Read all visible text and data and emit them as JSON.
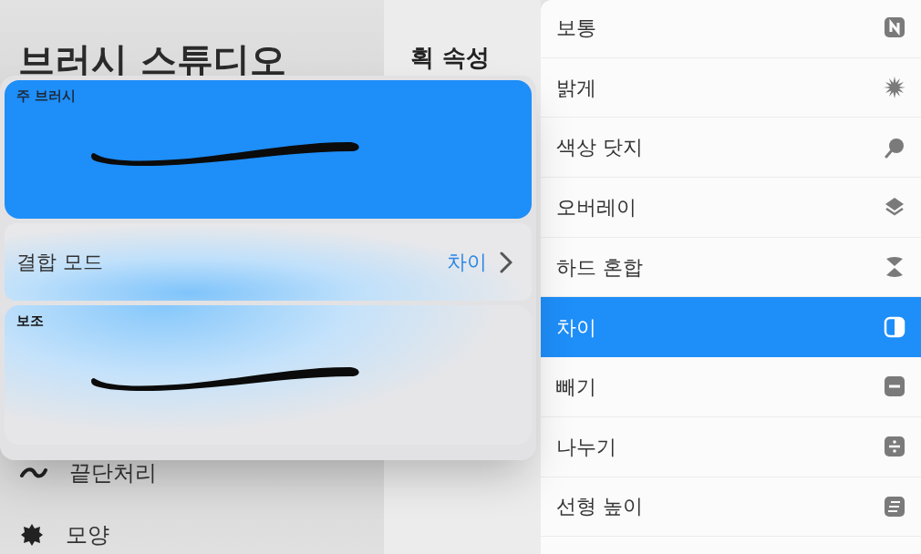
{
  "sidebar": {
    "title": "브러시 스튜디오",
    "items": [
      {
        "label": "끝단처리"
      },
      {
        "label": "모양"
      }
    ]
  },
  "section_title": "획 속성",
  "combine_panel": {
    "primary": {
      "label": "주 브러시"
    },
    "blend_mode": {
      "label": "결합 모드",
      "value": "차이"
    },
    "secondary": {
      "label": "보조"
    }
  },
  "blend_menu": [
    {
      "label": "보통",
      "selected": false
    },
    {
      "label": "밝게",
      "selected": false
    },
    {
      "label": "색상 닷지",
      "selected": false
    },
    {
      "label": "오버레이",
      "selected": false
    },
    {
      "label": "하드 혼합",
      "selected": false
    },
    {
      "label": "차이",
      "selected": true
    },
    {
      "label": "빼기",
      "selected": false
    },
    {
      "label": "나누기",
      "selected": false
    },
    {
      "label": "선형 높이",
      "selected": false
    }
  ]
}
